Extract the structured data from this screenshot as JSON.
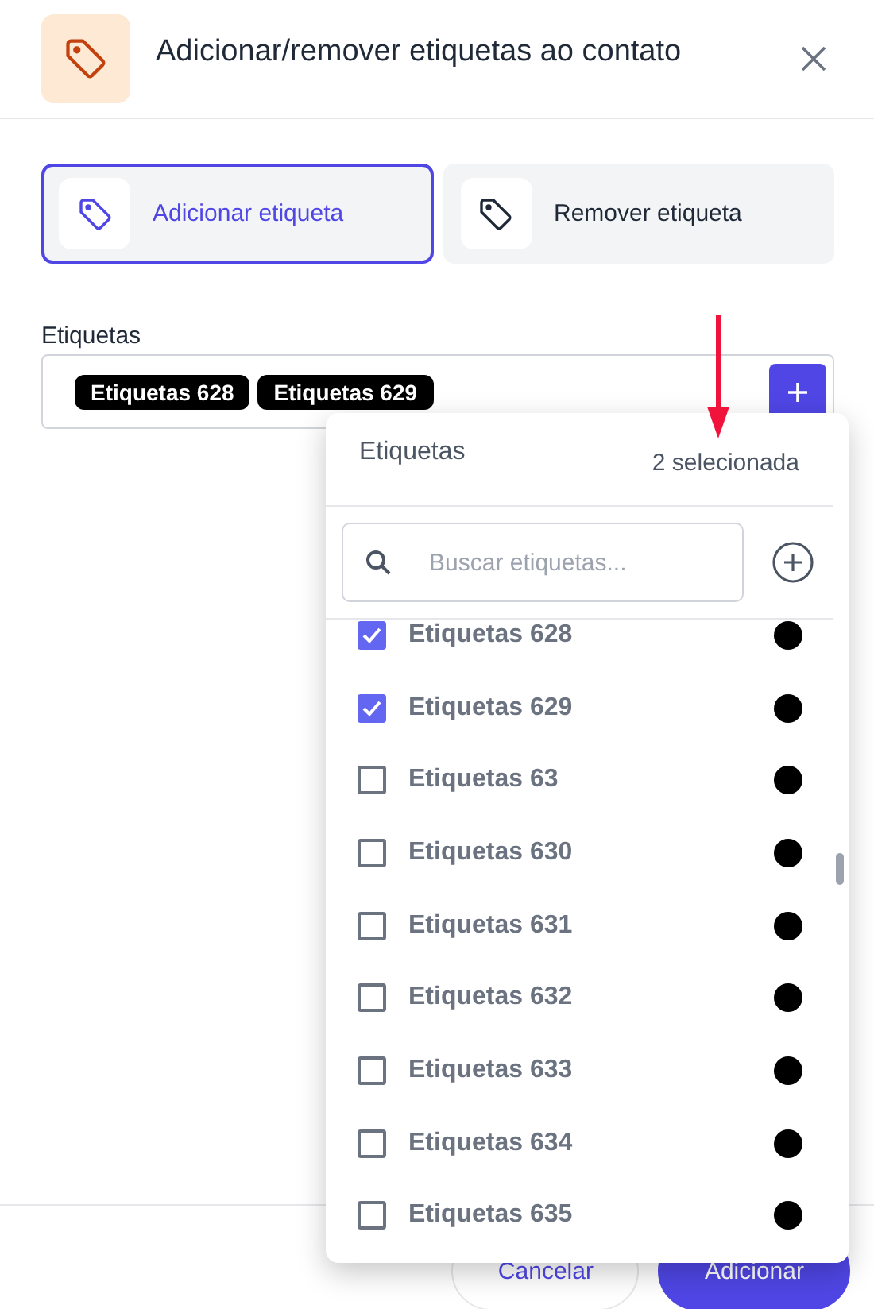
{
  "dialog": {
    "title": "Adicionar/remover etiquetas ao contato"
  },
  "modes": [
    {
      "label": "Adicionar etiqueta",
      "selected": true
    },
    {
      "label": "Remover etiqueta",
      "selected": false
    }
  ],
  "tags_field": {
    "label": "Etiquetas",
    "chips": [
      "Etiquetas 628",
      "Etiquetas 629"
    ]
  },
  "dropdown": {
    "title": "Etiquetas",
    "count": "2 selecionada",
    "search": {
      "placeholder": "Buscar etiquetas..."
    },
    "items": [
      {
        "label": "Etiquetas 628",
        "checked": true,
        "color": "#000000"
      },
      {
        "label": "Etiquetas 629",
        "checked": true,
        "color": "#000000"
      },
      {
        "label": "Etiquetas 63",
        "checked": false,
        "color": "#000000"
      },
      {
        "label": "Etiquetas 630",
        "checked": false,
        "color": "#000000"
      },
      {
        "label": "Etiquetas 631",
        "checked": false,
        "color": "#000000"
      },
      {
        "label": "Etiquetas 632",
        "checked": false,
        "color": "#000000"
      },
      {
        "label": "Etiquetas 633",
        "checked": false,
        "color": "#000000"
      },
      {
        "label": "Etiquetas 634",
        "checked": false,
        "color": "#000000"
      },
      {
        "label": "Etiquetas 635",
        "checked": false,
        "color": "#000000"
      }
    ]
  },
  "footer": {
    "buttons": [
      {
        "label": "Cancelar",
        "kind": "secondary"
      },
      {
        "label": "Adicionar",
        "kind": "primary"
      }
    ]
  }
}
